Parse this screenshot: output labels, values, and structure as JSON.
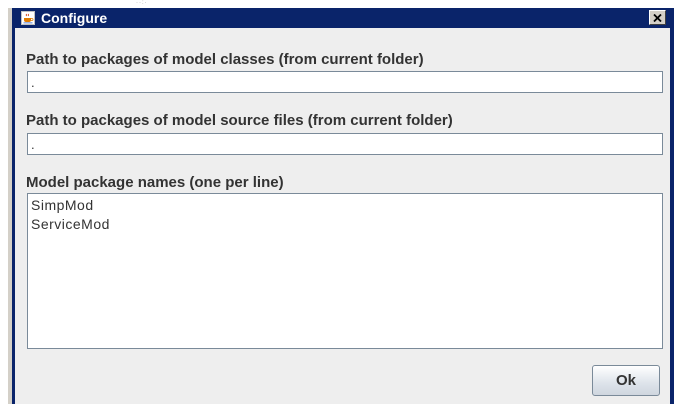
{
  "window": {
    "title": "Configure",
    "title_icon": "java-cup-icon",
    "close_icon": "close-icon",
    "titlebar_color": "#0a246a"
  },
  "stray_marks": "··:·",
  "fields": {
    "classes_path": {
      "label": "Path to packages of model classes (from current folder)",
      "value": "."
    },
    "sources_path": {
      "label": "Path to packages of model source files (from current folder)",
      "value": "."
    },
    "package_names": {
      "label": "Model package names (one per line)",
      "lines": [
        "SimpMod",
        "ServiceMod"
      ]
    }
  },
  "buttons": {
    "ok_label": "Ok"
  }
}
